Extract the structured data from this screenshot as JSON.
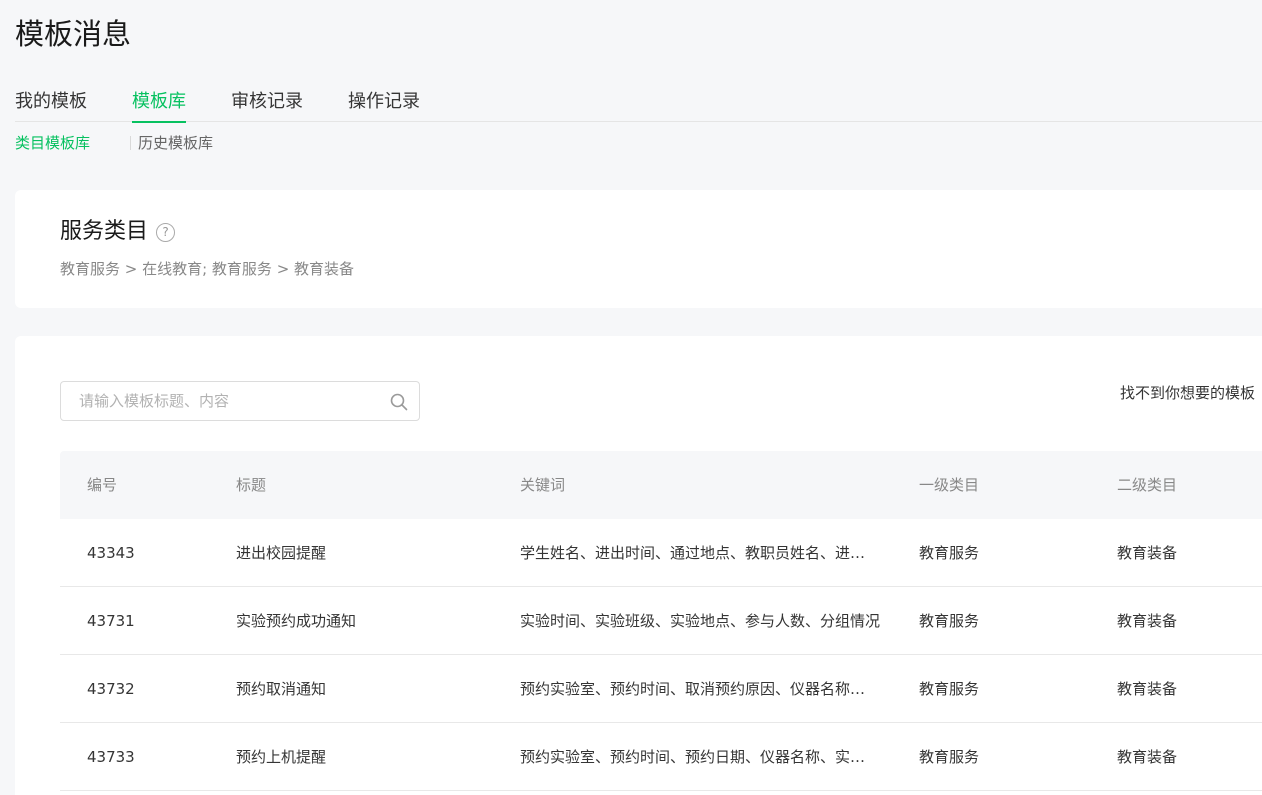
{
  "page": {
    "title": "模板消息"
  },
  "tabs": [
    {
      "label": "我的模板"
    },
    {
      "label": "模板库",
      "active": true
    },
    {
      "label": "审核记录"
    },
    {
      "label": "操作记录"
    }
  ],
  "subtabs": [
    {
      "label": "类目模板库",
      "active": true
    },
    {
      "label": "历史模板库"
    }
  ],
  "category": {
    "title": "服务类目",
    "help": "?",
    "path": "教育服务 > 在线教育; 教育服务 > 教育装备"
  },
  "search": {
    "placeholder": "请输入模板标题、内容",
    "value": ""
  },
  "not_found_link": "找不到你想要的模板",
  "table": {
    "headers": [
      "编号",
      "标题",
      "关键词",
      "一级类目",
      "二级类目"
    ],
    "rows": [
      {
        "id": "43343",
        "title": "进出校园提醒",
        "keywords": "学生姓名、进出时间、通过地点、教职员姓名、进出状态",
        "level1": "教育服务",
        "level2": "教育装备"
      },
      {
        "id": "43731",
        "title": "实验预约成功通知",
        "keywords": "实验时间、实验班级、实验地点、参与人数、分组情况",
        "level1": "教育服务",
        "level2": "教育装备"
      },
      {
        "id": "43732",
        "title": "预约取消通知",
        "keywords": "预约实验室、预约时间、取消预约原因、仪器名称、备注",
        "level1": "教育服务",
        "level2": "教育装备"
      },
      {
        "id": "43733",
        "title": "预约上机提醒",
        "keywords": "预约实验室、预约时间、预约日期、仪器名称、实验内容",
        "level1": "教育服务",
        "level2": "教育装备"
      }
    ]
  },
  "colors": {
    "accent": "#07c160",
    "background": "#f6f7f9",
    "card": "#ffffff"
  }
}
